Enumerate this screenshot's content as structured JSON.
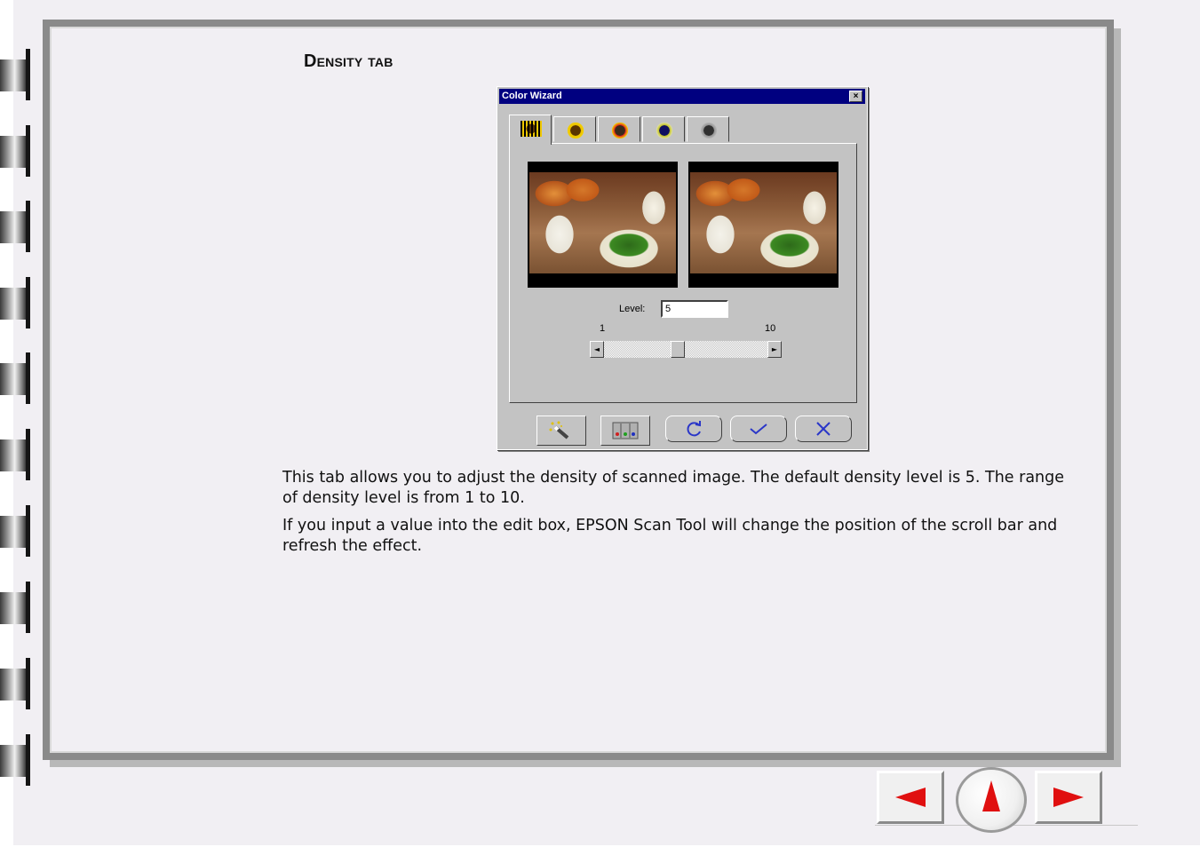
{
  "section": {
    "heading": "Density tab"
  },
  "dialog": {
    "title": "Color Wizard",
    "close_glyph": "×",
    "tabs": [
      {
        "icon": "density-icon",
        "active": true
      },
      {
        "icon": "brightness-icon",
        "active": false
      },
      {
        "icon": "red-balance-icon",
        "active": false
      },
      {
        "icon": "blue-balance-icon",
        "active": false
      },
      {
        "icon": "gray-balance-icon",
        "active": false
      }
    ],
    "previews": [
      {
        "name": "before-preview"
      },
      {
        "name": "after-preview"
      }
    ],
    "level": {
      "label": "Level:",
      "value": "5",
      "min_label": "1",
      "max_label": "10",
      "min": 1,
      "max": 10,
      "current": 5
    },
    "buttons": [
      {
        "name": "auto-wizard-button",
        "icon": "magic-wand-icon"
      },
      {
        "name": "levels-button",
        "icon": "histogram-icon"
      },
      {
        "name": "reset-button",
        "icon": "reset-icon"
      },
      {
        "name": "ok-button",
        "icon": "check-icon"
      },
      {
        "name": "cancel-button",
        "icon": "x-icon"
      }
    ]
  },
  "body": {
    "paragraph1": "This tab allows you to adjust the density of scanned image. The default density level is 5. The range of density level is from 1 to 10.",
    "paragraph2": "If you input a value into the edit box, EPSON Scan Tool will change the position of the scroll bar and refresh the effect."
  },
  "navigation": [
    {
      "name": "previous-page-button",
      "icon": "left-arrow-icon"
    },
    {
      "name": "top-page-button",
      "icon": "up-arrow-icon"
    },
    {
      "name": "next-page-button",
      "icon": "right-arrow-icon"
    }
  ],
  "colors": {
    "page_bg": "#f1eff3",
    "frame": "#8a8a8a",
    "dialog_bg": "#c3c3c3",
    "titlebar": "#000080",
    "nav_arrow": "#e01010",
    "icon_accent": "#2a36c8"
  }
}
